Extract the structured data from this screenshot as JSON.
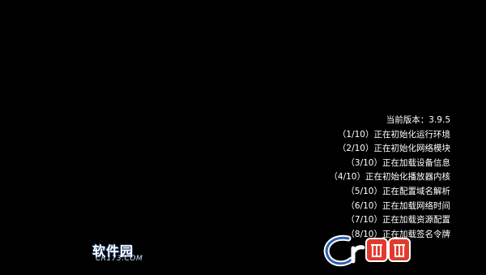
{
  "log": {
    "lines": [
      "当前版本：3.9.5",
      "（1/10）正在初始化运行环境",
      "（2/10）正在初始化网络模块",
      "（3/10）正在加载设备信息",
      "（4/10）正在初始化播放器内核",
      "（5/10）正在配置域名解析",
      "（6/10）正在加载网络时间",
      "（7/10）正在加载资源配置",
      "（8/10）正在加载签名令牌"
    ]
  },
  "watermark": {
    "site_name": "软件园",
    "url": "CR173.COM"
  },
  "colors": {
    "background": "#000000",
    "text": "#ffffff",
    "watermark_red": "#e23b2e",
    "watermark_blue": "#3a7be0"
  }
}
